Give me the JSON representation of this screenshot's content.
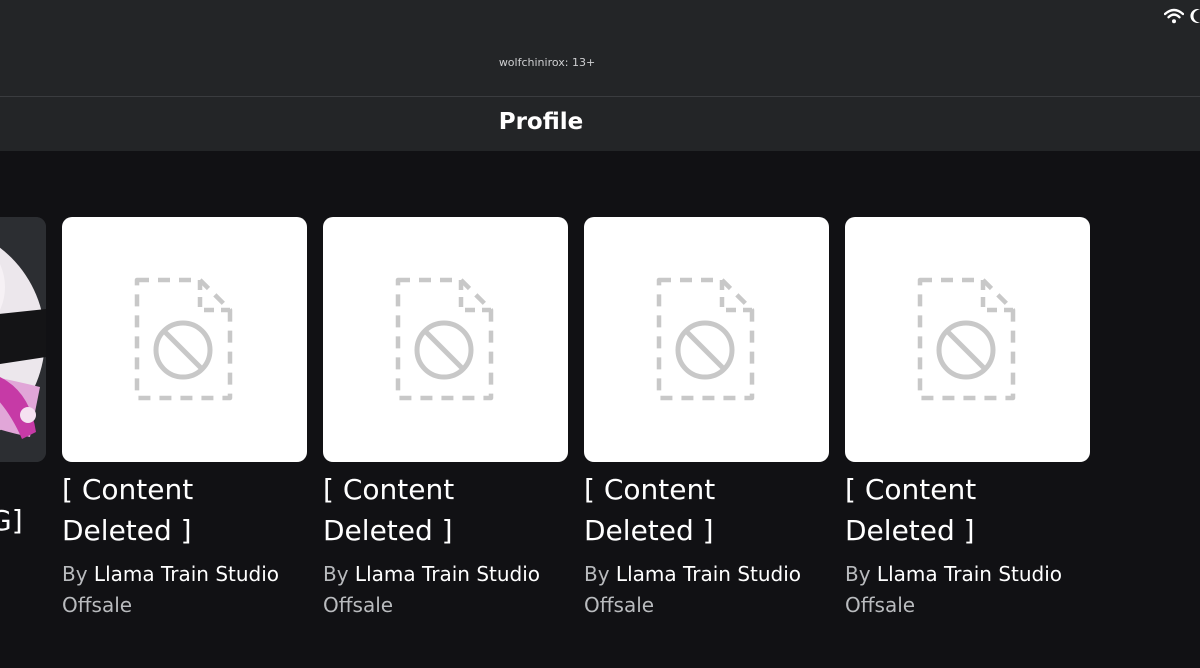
{
  "status": {
    "icons": [
      "wifi-icon",
      "moon-icon"
    ]
  },
  "user_label": "wolfchinirox: 13+",
  "header": {
    "title": "Profile"
  },
  "partial_item": {
    "name_fragment": "G]"
  },
  "items": [
    {
      "name": "[ Content Deleted ]",
      "by_prefix": "By",
      "creator": "Llama Train Studio",
      "price": "Offsale",
      "icon": "content-deleted-icon"
    },
    {
      "name": "[ Content Deleted ]",
      "by_prefix": "By",
      "creator": "Llama Train Studio",
      "price": "Offsale",
      "icon": "content-deleted-icon"
    },
    {
      "name": "[ Content Deleted ]",
      "by_prefix": "By",
      "creator": "Llama Train Studio",
      "price": "Offsale",
      "icon": "content-deleted-icon"
    },
    {
      "name": "[ Content Deleted ]",
      "by_prefix": "By",
      "creator": "Llama Train Studio",
      "price": "Offsale",
      "icon": "content-deleted-icon"
    }
  ],
  "colors": {
    "background": "#111114",
    "header_bg": "#232527",
    "card_bg": "#ffffff",
    "placeholder_icon": "#c8c8c8",
    "muted_text": "#b9bbbe"
  }
}
